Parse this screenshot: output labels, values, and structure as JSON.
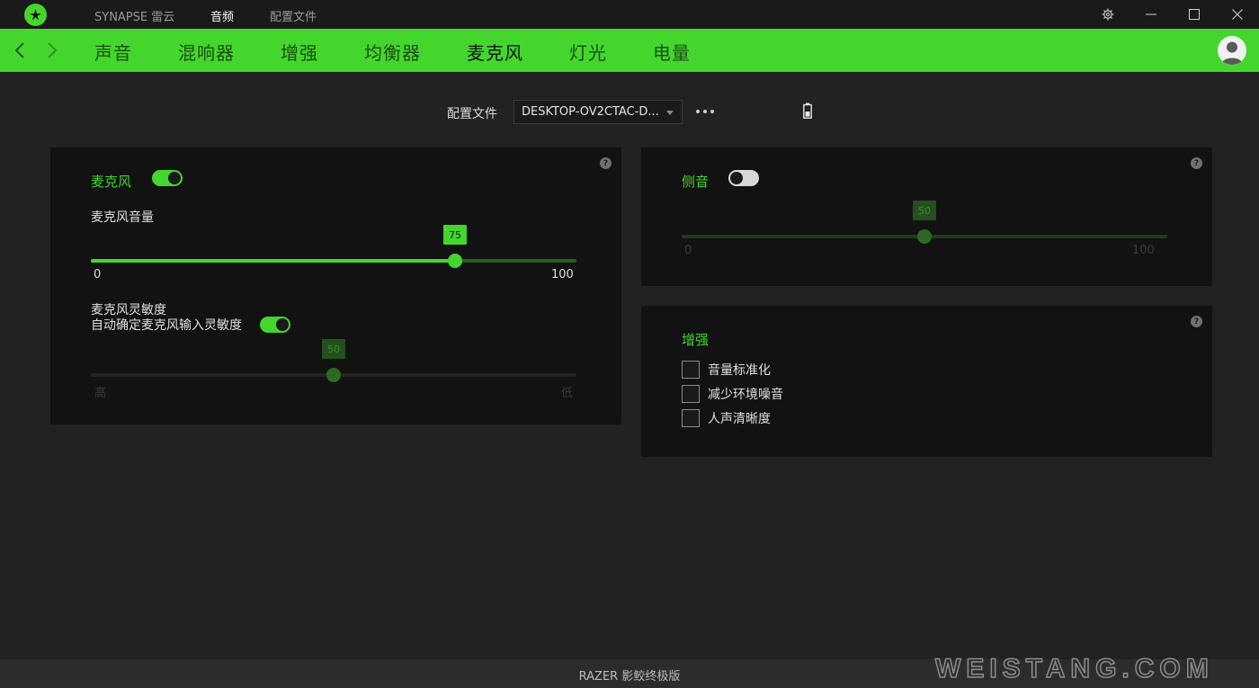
{
  "titlebar": {
    "tabs": [
      {
        "label": "SYNAPSE 雷云",
        "active": false
      },
      {
        "label": "音频",
        "active": true
      },
      {
        "label": "配置文件",
        "active": false
      }
    ]
  },
  "nav": {
    "tabs": [
      {
        "label": "声音",
        "active": false
      },
      {
        "label": "混响器",
        "active": false
      },
      {
        "label": "增强",
        "active": false
      },
      {
        "label": "均衡器",
        "active": false
      },
      {
        "label": "麦克风",
        "active": true
      },
      {
        "label": "灯光",
        "active": false
      },
      {
        "label": "电量",
        "active": false
      }
    ]
  },
  "profile": {
    "label": "配置文件",
    "selected": "DESKTOP-OV2CTAC-D..."
  },
  "mic_panel": {
    "title": "麦克风",
    "enabled": true,
    "volume": {
      "label": "麦克风音量",
      "value": 75,
      "min_label": "0",
      "max_label": "100",
      "bubble": "75"
    },
    "sensitivity": {
      "label": "麦克风灵敏度",
      "auto_label": "自动确定麦克风输入灵敏度",
      "auto_enabled": true,
      "value": 50,
      "bubble": "50",
      "min_label": "高",
      "max_label": "低",
      "disabled": true
    }
  },
  "sidetone_panel": {
    "title": "侧音",
    "enabled": false,
    "value": 50,
    "bubble": "50",
    "min_label": "0",
    "max_label": "100"
  },
  "enhance_panel": {
    "title": "增强",
    "options": [
      {
        "label": "音量标准化",
        "checked": false
      },
      {
        "label": "减少环境噪音",
        "checked": false
      },
      {
        "label": "人声清晰度",
        "checked": false
      }
    ]
  },
  "footer": {
    "device_name": "RAZER 影鲛终极版"
  },
  "watermark": "WEISTANG.COM",
  "colors": {
    "accent": "#44d62c",
    "background": "#222222",
    "panel": "#121212",
    "disabled_green": "#2c5a24"
  },
  "icons": {
    "logo": "razer-logo-icon",
    "settings": "gear-icon",
    "minimize": "minimize-icon",
    "maximize": "maximize-icon",
    "close": "close-icon",
    "back": "chevron-left-icon",
    "forward": "chevron-right-icon",
    "battery": "battery-icon",
    "help": "question-icon",
    "user": "user-avatar-icon"
  }
}
